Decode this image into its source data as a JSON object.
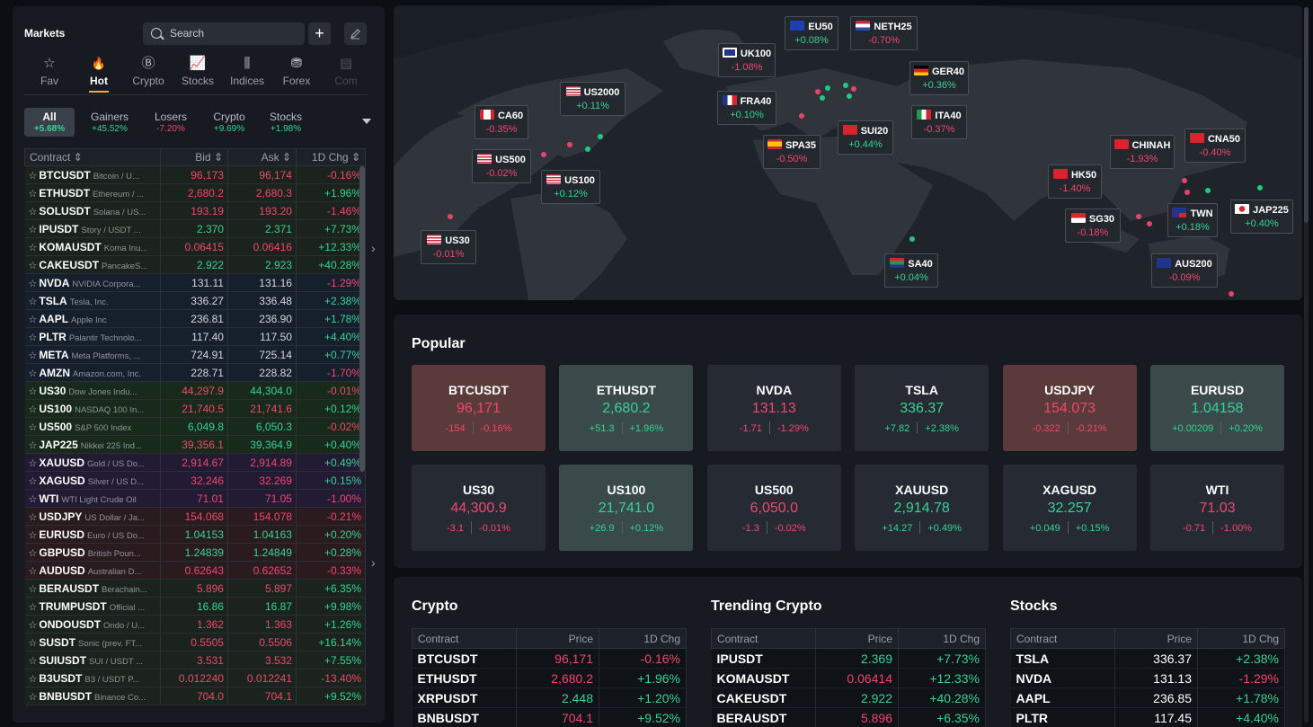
{
  "markets": {
    "title": "Markets",
    "search_placeholder": "Search",
    "add_icon": "plus-icon",
    "edit_icon": "pencil-icon",
    "categories": [
      {
        "label": "Fav",
        "icon": "star-icon"
      },
      {
        "label": "Hot",
        "icon": "flame-icon"
      },
      {
        "label": "Crypto",
        "icon": "bitcoin-icon"
      },
      {
        "label": "Stocks",
        "icon": "chart-line-icon"
      },
      {
        "label": "Indices",
        "icon": "candlestick-icon"
      },
      {
        "label": "Forex",
        "icon": "coins-icon"
      },
      {
        "label": "Com",
        "icon": "commodity-icon"
      }
    ],
    "active_category": "Hot",
    "filters": [
      {
        "label": "All",
        "value": "+5.68%",
        "dir": "up"
      },
      {
        "label": "Gainers",
        "value": "+45.52%",
        "dir": "up"
      },
      {
        "label": "Losers",
        "value": "-7.20%",
        "dir": "dn"
      },
      {
        "label": "Crypto",
        "value": "+9.69%",
        "dir": "up"
      },
      {
        "label": "Stocks",
        "value": "+1.98%",
        "dir": "up"
      }
    ],
    "columns": [
      "Contract",
      "Bid",
      "Ask",
      "1D Chg"
    ],
    "rows": [
      {
        "code": "BTCUSDT",
        "desc": "Bitcoin / U...",
        "bid": "96,173",
        "ask": "96,174",
        "chg": "-0.16%",
        "bd": "dn",
        "ad": "dn",
        "cd": "dn",
        "grp": "crypto"
      },
      {
        "code": "ETHUSDT",
        "desc": "Ethereum / ...",
        "bid": "2,680.2",
        "ask": "2,680.3",
        "chg": "+1.96%",
        "bd": "dn",
        "ad": "dn",
        "cd": "up",
        "grp": "crypto"
      },
      {
        "code": "SOLUSDT",
        "desc": "Solana / US...",
        "bid": "193.19",
        "ask": "193.20",
        "chg": "-1.46%",
        "bd": "dn",
        "ad": "dn",
        "cd": "dn",
        "grp": "crypto"
      },
      {
        "code": "IPUSDT",
        "desc": "Story / USDT ...",
        "bid": "2.370",
        "ask": "2.371",
        "chg": "+7.73%",
        "bd": "up",
        "ad": "up",
        "cd": "up",
        "grp": "crypto"
      },
      {
        "code": "KOMAUSDT",
        "desc": "Koma Inu...",
        "bid": "0.06415",
        "ask": "0.06416",
        "chg": "+12.33%",
        "bd": "dn",
        "ad": "dn",
        "cd": "up",
        "grp": "crypto"
      },
      {
        "code": "CAKEUSDT",
        "desc": "PancakeS...",
        "bid": "2.922",
        "ask": "2.923",
        "chg": "+40.28%",
        "bd": "up",
        "ad": "up",
        "cd": "up",
        "grp": "crypto"
      },
      {
        "code": "NVDA",
        "desc": "NVIDIA Corpora...",
        "bid": "131.11",
        "ask": "131.16",
        "chg": "-1.29%",
        "bd": "w",
        "ad": "w",
        "cd": "dn",
        "grp": "stock"
      },
      {
        "code": "TSLA",
        "desc": "Tesla, Inc.",
        "bid": "336.27",
        "ask": "336.48",
        "chg": "+2.38%",
        "bd": "w",
        "ad": "w",
        "cd": "up",
        "grp": "stock"
      },
      {
        "code": "AAPL",
        "desc": "Apple Inc",
        "bid": "236.81",
        "ask": "236.90",
        "chg": "+1.78%",
        "bd": "w",
        "ad": "w",
        "cd": "up",
        "grp": "stock"
      },
      {
        "code": "PLTR",
        "desc": "Palantir Technolo...",
        "bid": "117.40",
        "ask": "117.50",
        "chg": "+4.40%",
        "bd": "w",
        "ad": "w",
        "cd": "up",
        "grp": "stock"
      },
      {
        "code": "META",
        "desc": "Meta Platforms, ...",
        "bid": "724.91",
        "ask": "725.14",
        "chg": "+0.77%",
        "bd": "w",
        "ad": "w",
        "cd": "up",
        "grp": "stock"
      },
      {
        "code": "AMZN",
        "desc": "Amazon.com, Inc.",
        "bid": "228.71",
        "ask": "228.82",
        "chg": "-1.70%",
        "bd": "w",
        "ad": "w",
        "cd": "dn",
        "grp": "stock"
      },
      {
        "code": "US30",
        "desc": "Dow Jones Indu...",
        "bid": "44,297.9",
        "ask": "44,304.0",
        "chg": "-0.01%",
        "bd": "dn",
        "ad": "up",
        "cd": "dn",
        "grp": "index"
      },
      {
        "code": "US100",
        "desc": "NASDAQ 100 In...",
        "bid": "21,740.5",
        "ask": "21,741.6",
        "chg": "+0.12%",
        "bd": "dn",
        "ad": "dn",
        "cd": "up",
        "grp": "index"
      },
      {
        "code": "US500",
        "desc": "S&P 500 Index",
        "bid": "6,049.8",
        "ask": "6,050.3",
        "chg": "-0.02%",
        "bd": "up",
        "ad": "up",
        "cd": "dn",
        "grp": "index"
      },
      {
        "code": "JAP225",
        "desc": "Nikkei 225 Ind...",
        "bid": "39,356.1",
        "ask": "39,364.9",
        "chg": "+0.40%",
        "bd": "dn",
        "ad": "up",
        "cd": "up",
        "grp": "index"
      },
      {
        "code": "XAUUSD",
        "desc": "Gold / US Do...",
        "bid": "2,914.67",
        "ask": "2,914.89",
        "chg": "+0.49%",
        "bd": "dn",
        "ad": "dn",
        "cd": "up",
        "grp": "metal"
      },
      {
        "code": "XAGUSD",
        "desc": "Silver / US D...",
        "bid": "32.246",
        "ask": "32.269",
        "chg": "+0.15%",
        "bd": "dn",
        "ad": "dn",
        "cd": "up",
        "grp": "metal"
      },
      {
        "code": "WTI",
        "desc": "WTI Light Crude Oil",
        "bid": "71.01",
        "ask": "71.05",
        "chg": "-1.00%",
        "bd": "dn",
        "ad": "dn",
        "cd": "dn",
        "grp": "metal"
      },
      {
        "code": "USDJPY",
        "desc": "US Dollar / Ja...",
        "bid": "154.068",
        "ask": "154.078",
        "chg": "-0.21%",
        "bd": "dn",
        "ad": "dn",
        "cd": "dn",
        "grp": "fx"
      },
      {
        "code": "EURUSD",
        "desc": "Euro / US Do...",
        "bid": "1.04153",
        "ask": "1.04163",
        "chg": "+0.20%",
        "bd": "up",
        "ad": "up",
        "cd": "up",
        "grp": "fx"
      },
      {
        "code": "GBPUSD",
        "desc": "British Poun...",
        "bid": "1.24839",
        "ask": "1.24849",
        "chg": "+0.28%",
        "bd": "up",
        "ad": "up",
        "cd": "up",
        "grp": "fx"
      },
      {
        "code": "AUDUSD",
        "desc": "Australian D...",
        "bid": "0.62643",
        "ask": "0.62652",
        "chg": "-0.33%",
        "bd": "dn",
        "ad": "dn",
        "cd": "dn",
        "grp": "fx"
      },
      {
        "code": "BERAUSDT",
        "desc": "Berachain...",
        "bid": "5.896",
        "ask": "5.897",
        "chg": "+6.35%",
        "bd": "dn",
        "ad": "dn",
        "cd": "up",
        "grp": "crypto"
      },
      {
        "code": "TRUMPUSDT",
        "desc": "Official ...",
        "bid": "16.86",
        "ask": "16.87",
        "chg": "+9.98%",
        "bd": "up",
        "ad": "up",
        "cd": "up",
        "grp": "crypto"
      },
      {
        "code": "ONDOUSDT",
        "desc": "Ondo / U...",
        "bid": "1.362",
        "ask": "1.363",
        "chg": "+1.26%",
        "bd": "dn",
        "ad": "dn",
        "cd": "up",
        "grp": "crypto"
      },
      {
        "code": "SUSDT",
        "desc": "Sonic (prev. FT...",
        "bid": "0.5505",
        "ask": "0.5506",
        "chg": "+16.14%",
        "bd": "dn",
        "ad": "dn",
        "cd": "up",
        "grp": "crypto"
      },
      {
        "code": "SUIUSDT",
        "desc": "SUI / USDT ...",
        "bid": "3.531",
        "ask": "3.532",
        "chg": "+7.55%",
        "bd": "dn",
        "ad": "dn",
        "cd": "up",
        "grp": "crypto"
      },
      {
        "code": "B3USDT",
        "desc": "B3 / USDT P...",
        "bid": "0.012240",
        "ask": "0.012241",
        "chg": "-13.40%",
        "bd": "dn",
        "ad": "dn",
        "cd": "dn",
        "grp": "crypto"
      },
      {
        "code": "BNBUSDT",
        "desc": "Binance Co...",
        "bid": "704.0",
        "ask": "704.1",
        "chg": "+9.52%",
        "bd": "dn",
        "ad": "dn",
        "cd": "up",
        "grp": "crypto"
      }
    ]
  },
  "map": {
    "labels": [
      {
        "name": "EU50",
        "chg": "+0.08%",
        "dir": "up",
        "flag": "eu"
      },
      {
        "name": "NETH25",
        "chg": "-0.70%",
        "dir": "dn",
        "flag": "nl"
      },
      {
        "name": "UK100",
        "chg": "-1.08%",
        "dir": "dn",
        "flag": "uk"
      },
      {
        "name": "GER40",
        "chg": "+0.36%",
        "dir": "up",
        "flag": "de"
      },
      {
        "name": "US2000",
        "chg": "+0.11%",
        "dir": "up",
        "flag": "us"
      },
      {
        "name": "FRA40",
        "chg": "+0.10%",
        "dir": "up",
        "flag": "fr"
      },
      {
        "name": "CA60",
        "chg": "-0.35%",
        "dir": "dn",
        "flag": "ca"
      },
      {
        "name": "ITA40",
        "chg": "-0.37%",
        "dir": "dn",
        "flag": "it"
      },
      {
        "name": "SUI20",
        "chg": "+0.44%",
        "dir": "up",
        "flag": "ch"
      },
      {
        "name": "SPA35",
        "chg": "-0.50%",
        "dir": "dn",
        "flag": "es"
      },
      {
        "name": "CHINAH",
        "chg": "-1.93%",
        "dir": "dn",
        "flag": "cn"
      },
      {
        "name": "CNA50",
        "chg": "-0.40%",
        "dir": "dn",
        "flag": "cn"
      },
      {
        "name": "US500",
        "chg": "-0.02%",
        "dir": "dn",
        "flag": "us"
      },
      {
        "name": "US100",
        "chg": "+0.12%",
        "dir": "up",
        "flag": "us"
      },
      {
        "name": "HK50",
        "chg": "-1.40%",
        "dir": "dn",
        "flag": "hk"
      },
      {
        "name": "SG30",
        "chg": "-0.18%",
        "dir": "dn",
        "flag": "sg"
      },
      {
        "name": "TWN",
        "chg": "+0.18%",
        "dir": "up",
        "flag": "tw"
      },
      {
        "name": "JAP225",
        "chg": "+0.40%",
        "dir": "up",
        "flag": "jp"
      },
      {
        "name": "US30",
        "chg": "-0.01%",
        "dir": "dn",
        "flag": "us"
      },
      {
        "name": "SA40",
        "chg": "+0.04%",
        "dir": "up",
        "flag": "za"
      },
      {
        "name": "AUS200",
        "chg": "-0.09%",
        "dir": "dn",
        "flag": "au"
      }
    ]
  },
  "popular": {
    "title": "Popular",
    "cards": [
      {
        "name": "BTCUSDT",
        "price": "96,171",
        "abs": "-154",
        "pct": "-0.16%",
        "dir": "dn",
        "bg": "dn-bg"
      },
      {
        "name": "ETHUSDT",
        "price": "2,680.2",
        "abs": "+51.3",
        "pct": "+1.96%",
        "dir": "up",
        "bg": "up-bg"
      },
      {
        "name": "NVDA",
        "price": "131.13",
        "abs": "-1.71",
        "pct": "-1.29%",
        "dir": "dn",
        "bg": "neutral"
      },
      {
        "name": "TSLA",
        "price": "336.37",
        "abs": "+7.82",
        "pct": "+2.38%",
        "dir": "up",
        "bg": "neutral"
      },
      {
        "name": "USDJPY",
        "price": "154.073",
        "abs": "-0.322",
        "pct": "-0.21%",
        "dir": "dn",
        "bg": "dn-bg"
      },
      {
        "name": "EURUSD",
        "price": "1.04158",
        "abs": "+0.00209",
        "pct": "+0.20%",
        "dir": "up",
        "bg": "up-bg"
      },
      {
        "name": "US30",
        "price": "44,300.9",
        "abs": "-3.1",
        "pct": "-0.01%",
        "dir": "dn",
        "bg": "neutral"
      },
      {
        "name": "US100",
        "price": "21,741.0",
        "abs": "+26.9",
        "pct": "+0.12%",
        "dir": "up",
        "bg": "up-bg"
      },
      {
        "name": "US500",
        "price": "6,050.0",
        "abs": "-1.3",
        "pct": "-0.02%",
        "dir": "dn",
        "bg": "neutral"
      },
      {
        "name": "XAUUSD",
        "price": "2,914.78",
        "abs": "+14.27",
        "pct": "+0.49%",
        "dir": "up",
        "bg": "neutral"
      },
      {
        "name": "XAGUSD",
        "price": "32.257",
        "abs": "+0.049",
        "pct": "+0.15%",
        "dir": "up",
        "bg": "neutral"
      },
      {
        "name": "WTI",
        "price": "71.03",
        "abs": "-0.71",
        "pct": "-1.00%",
        "dir": "dn",
        "bg": "neutral"
      }
    ]
  },
  "lists": [
    {
      "title": "Crypto",
      "columns": [
        "Contract",
        "Price",
        "1D Chg"
      ],
      "rows": [
        {
          "c": "BTCUSDT",
          "p": "96,171",
          "pd": "dn",
          "chg": "-0.16%",
          "cd": "dn"
        },
        {
          "c": "ETHUSDT",
          "p": "2,680.2",
          "pd": "dn",
          "chg": "+1.96%",
          "cd": "up"
        },
        {
          "c": "XRPUSDT",
          "p": "2.448",
          "pd": "up",
          "chg": "+1.20%",
          "cd": "up"
        },
        {
          "c": "BNBUSDT",
          "p": "704.1",
          "pd": "dn",
          "chg": "+9.52%",
          "cd": "up"
        }
      ]
    },
    {
      "title": "Trending Crypto",
      "columns": [
        "Contract",
        "Price",
        "1D Chg"
      ],
      "rows": [
        {
          "c": "IPUSDT",
          "p": "2.369",
          "pd": "up",
          "chg": "+7.73%",
          "cd": "up"
        },
        {
          "c": "KOMAUSDT",
          "p": "0.06414",
          "pd": "dn",
          "chg": "+12.33%",
          "cd": "up"
        },
        {
          "c": "CAKEUSDT",
          "p": "2.922",
          "pd": "up",
          "chg": "+40.28%",
          "cd": "up"
        },
        {
          "c": "BERAUSDT",
          "p": "5.896",
          "pd": "dn",
          "chg": "+6.35%",
          "cd": "up"
        }
      ]
    },
    {
      "title": "Stocks",
      "columns": [
        "Contract",
        "Price",
        "1D Chg"
      ],
      "rows": [
        {
          "c": "TSLA",
          "p": "336.37",
          "pd": "w",
          "chg": "+2.38%",
          "cd": "up"
        },
        {
          "c": "NVDA",
          "p": "131.13",
          "pd": "w",
          "chg": "-1.29%",
          "cd": "dn"
        },
        {
          "c": "AAPL",
          "p": "236.85",
          "pd": "w",
          "chg": "+1.78%",
          "cd": "up"
        },
        {
          "c": "PLTR",
          "p": "117.45",
          "pd": "w",
          "chg": "+4.40%",
          "cd": "up"
        }
      ]
    }
  ],
  "colors": {
    "up": "#37d296",
    "down": "#f2466e",
    "accent": "#f0a64b"
  }
}
